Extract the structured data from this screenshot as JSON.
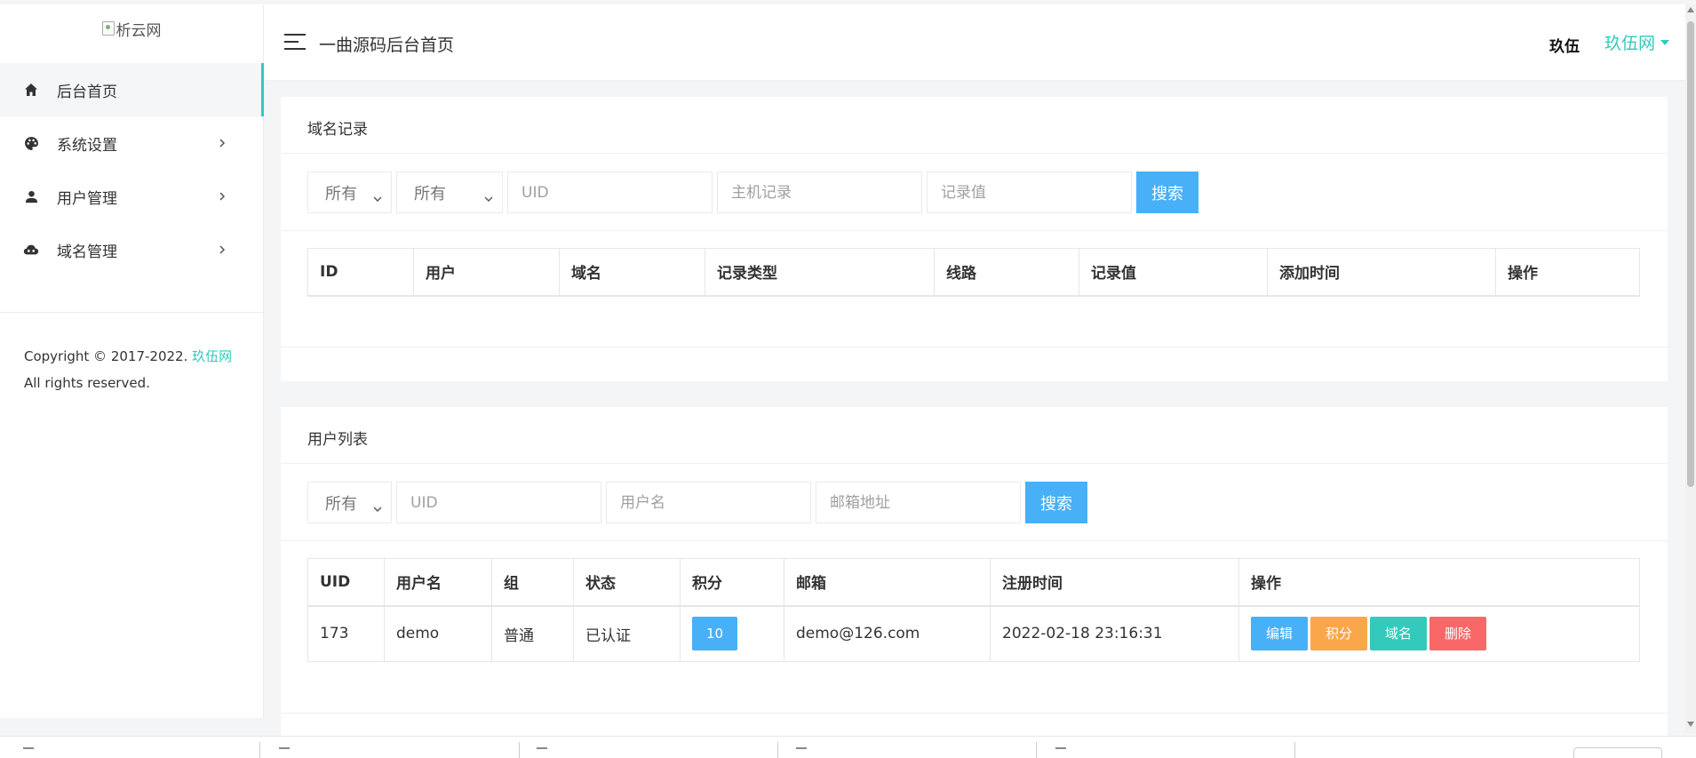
{
  "sidebar": {
    "logo_alt": "析云网",
    "items": [
      {
        "label": "后台首页",
        "icon": "home-icon",
        "active": true
      },
      {
        "label": "系统设置",
        "icon": "palette-icon",
        "has_children": true
      },
      {
        "label": "用户管理",
        "icon": "user-icon",
        "has_children": true
      },
      {
        "label": "域名管理",
        "icon": "cloud-icon",
        "has_children": true
      }
    ],
    "copyright_prefix": "Copyright © 2017-2022. ",
    "copyright_link": "玖伍网",
    "copyright_suffix": "All rights reserved."
  },
  "header": {
    "title": "一曲源码后台首页",
    "user_name": "玖伍",
    "site_menu": "玖伍网"
  },
  "domain_records": {
    "title": "域名记录",
    "filters": {
      "select1": "所有",
      "select2": "所有",
      "uid_placeholder": "UID",
      "host_placeholder": "主机记录",
      "value_placeholder": "记录值",
      "search_label": "搜索"
    },
    "columns": [
      "ID",
      "用户",
      "域名",
      "记录类型",
      "线路",
      "记录值",
      "添加时间",
      "操作"
    ],
    "rows": []
  },
  "user_list": {
    "title": "用户列表",
    "filters": {
      "select1": "所有",
      "uid_placeholder": "UID",
      "username_placeholder": "用户名",
      "email_placeholder": "邮箱地址",
      "search_label": "搜索"
    },
    "columns": [
      "UID",
      "用户名",
      "组",
      "状态",
      "积分",
      "邮箱",
      "注册时间",
      "操作"
    ],
    "rows": [
      {
        "uid": "173",
        "username": "demo",
        "group": "普通",
        "status": "已认证",
        "points": "10",
        "email": "demo@126.com",
        "registered": "2022-02-18 23:16:31",
        "actions": [
          "编辑",
          "积分",
          "域名",
          "删除"
        ]
      }
    ]
  },
  "colors": {
    "accent": "#33cabb",
    "primary": "#48b0f7",
    "warning": "#faa64b",
    "danger": "#f96868"
  }
}
